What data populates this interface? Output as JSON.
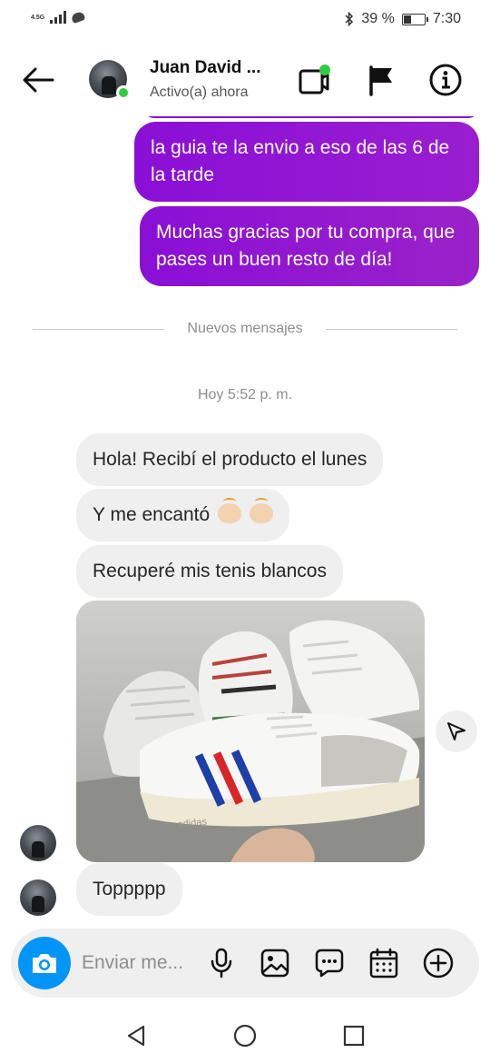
{
  "status_bar": {
    "network": "4.5G",
    "battery_text": "39 %",
    "battery_level": 0.39,
    "time": "7:30"
  },
  "header": {
    "contact_name": "Juan David ...",
    "contact_status": "Activo(a) ahora",
    "icons": [
      "back-arrow-icon",
      "video-call-icon",
      "flag-icon",
      "info-icon"
    ]
  },
  "chat": {
    "outgoing": [
      "la guia te la envio a eso de las 6 de la tarde",
      "Muchas gracias por tu compra, que pases un buen resto de día!"
    ],
    "new_messages_label": "Nuevos mensajes",
    "timestamp": "Hoy 5:52 p. m.",
    "incoming": [
      "Hola! Recibí el producto el lunes",
      "Y me encantó",
      "Recuperé mis tenis blancos",
      "Toppppp"
    ],
    "photo_brand_text": "adidas"
  },
  "composer": {
    "placeholder": "Enviar me...",
    "icons": [
      "camera-icon",
      "microphone-icon",
      "gallery-icon",
      "sticker-icon",
      "calendar-icon",
      "plus-icon"
    ]
  },
  "colors": {
    "outgoing_gradient_start": "#8a0fd6",
    "outgoing_gradient_end": "#9b22c9",
    "incoming_bg": "#efefef",
    "accent_blue": "#0095f6",
    "online": "#2ecc40"
  }
}
